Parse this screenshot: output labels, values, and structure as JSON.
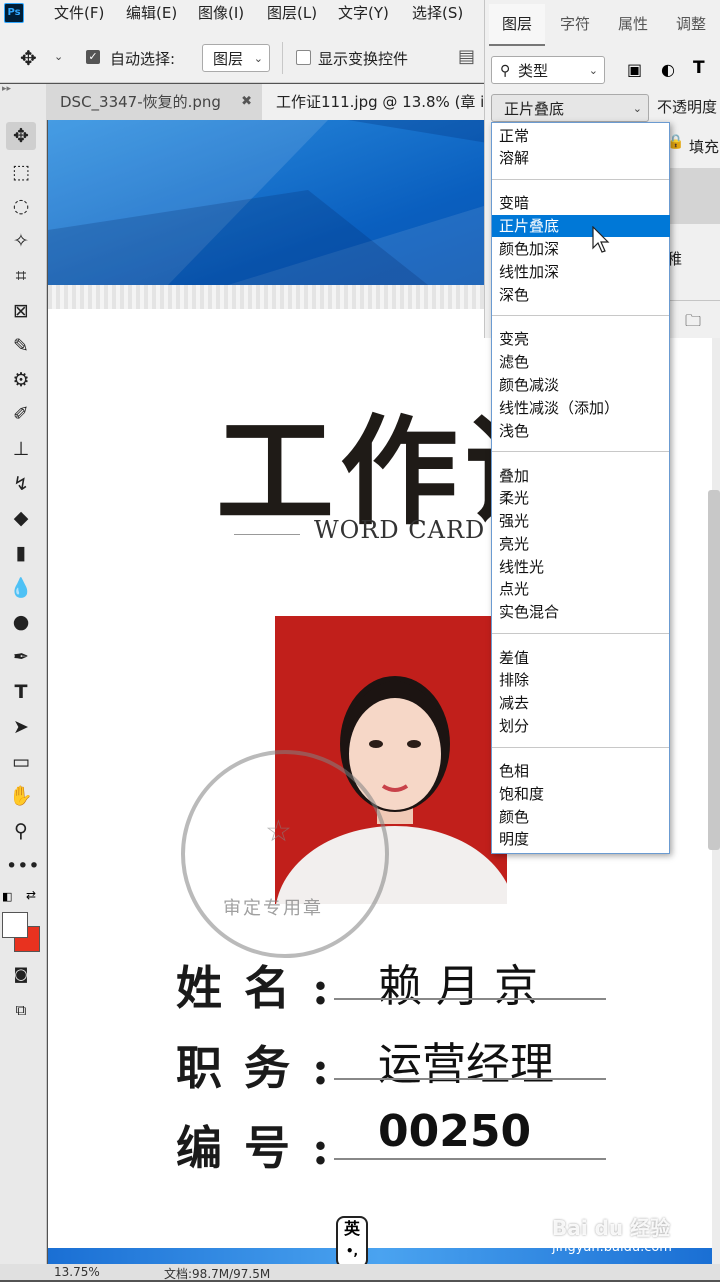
{
  "app": {
    "logo": "Ps"
  },
  "menubar": {
    "items": [
      "文件(F)",
      "编辑(E)",
      "图像(I)",
      "图层(L)",
      "文字(Y)",
      "选择(S)"
    ]
  },
  "options": {
    "auto_select_label": "自动选择:",
    "auto_select_checked": true,
    "auto_select_target": "图层",
    "show_transform_label": "显示变换控件",
    "show_transform_checked": false
  },
  "tabs": [
    {
      "label": "DSC_3347-恢复的.png",
      "close": "✖",
      "active": false
    },
    {
      "label": "工作证111.jpg @ 13.8% (章 i",
      "active": true
    }
  ],
  "layers_panel": {
    "tabs": [
      "图层",
      "字符",
      "属性",
      "调整"
    ],
    "active_tab": "图层",
    "filter_kind": "类型",
    "blend_mode": "正片叠底",
    "opacity_label": "不透明度",
    "fill_label": "填充",
    "layer_fragment": "稚"
  },
  "blend_dropdown": {
    "groups": [
      [
        "正常",
        "溶解"
      ],
      [
        "变暗",
        "正片叠底",
        "颜色加深",
        "线性加深",
        "深色"
      ],
      [
        "变亮",
        "滤色",
        "颜色减淡",
        "线性减淡（添加）",
        "浅色"
      ],
      [
        "叠加",
        "柔光",
        "强光",
        "亮光",
        "线性光",
        "点光",
        "实色混合"
      ],
      [
        "差值",
        "排除",
        "减去",
        "划分"
      ],
      [
        "色相",
        "饱和度",
        "颜色",
        "明度"
      ]
    ],
    "selected": "正片叠底"
  },
  "card": {
    "title": "工作证",
    "subtitle": "WORD CARD",
    "stamp_text": "审定专用章",
    "fields": [
      {
        "label": "姓名:",
        "value": "赖月京"
      },
      {
        "label": "职务:",
        "value": "运营经理"
      },
      {
        "label": "编号:",
        "value": "00250"
      }
    ]
  },
  "status": {
    "zoom": "13.75%",
    "doc_info": "文档:98.7M/97.5M"
  },
  "watermark": {
    "brand": "Bai du 经验",
    "url": "jingyan.baidu.com"
  },
  "ime_badge": {
    "lang": "英",
    "punct": "•,"
  },
  "colors": {
    "accent": "#0078d7",
    "foreground": "#ffffff",
    "background": "#e8321f",
    "card_photo_bg": "#c11f1b",
    "banner": "#0a5fbf"
  }
}
